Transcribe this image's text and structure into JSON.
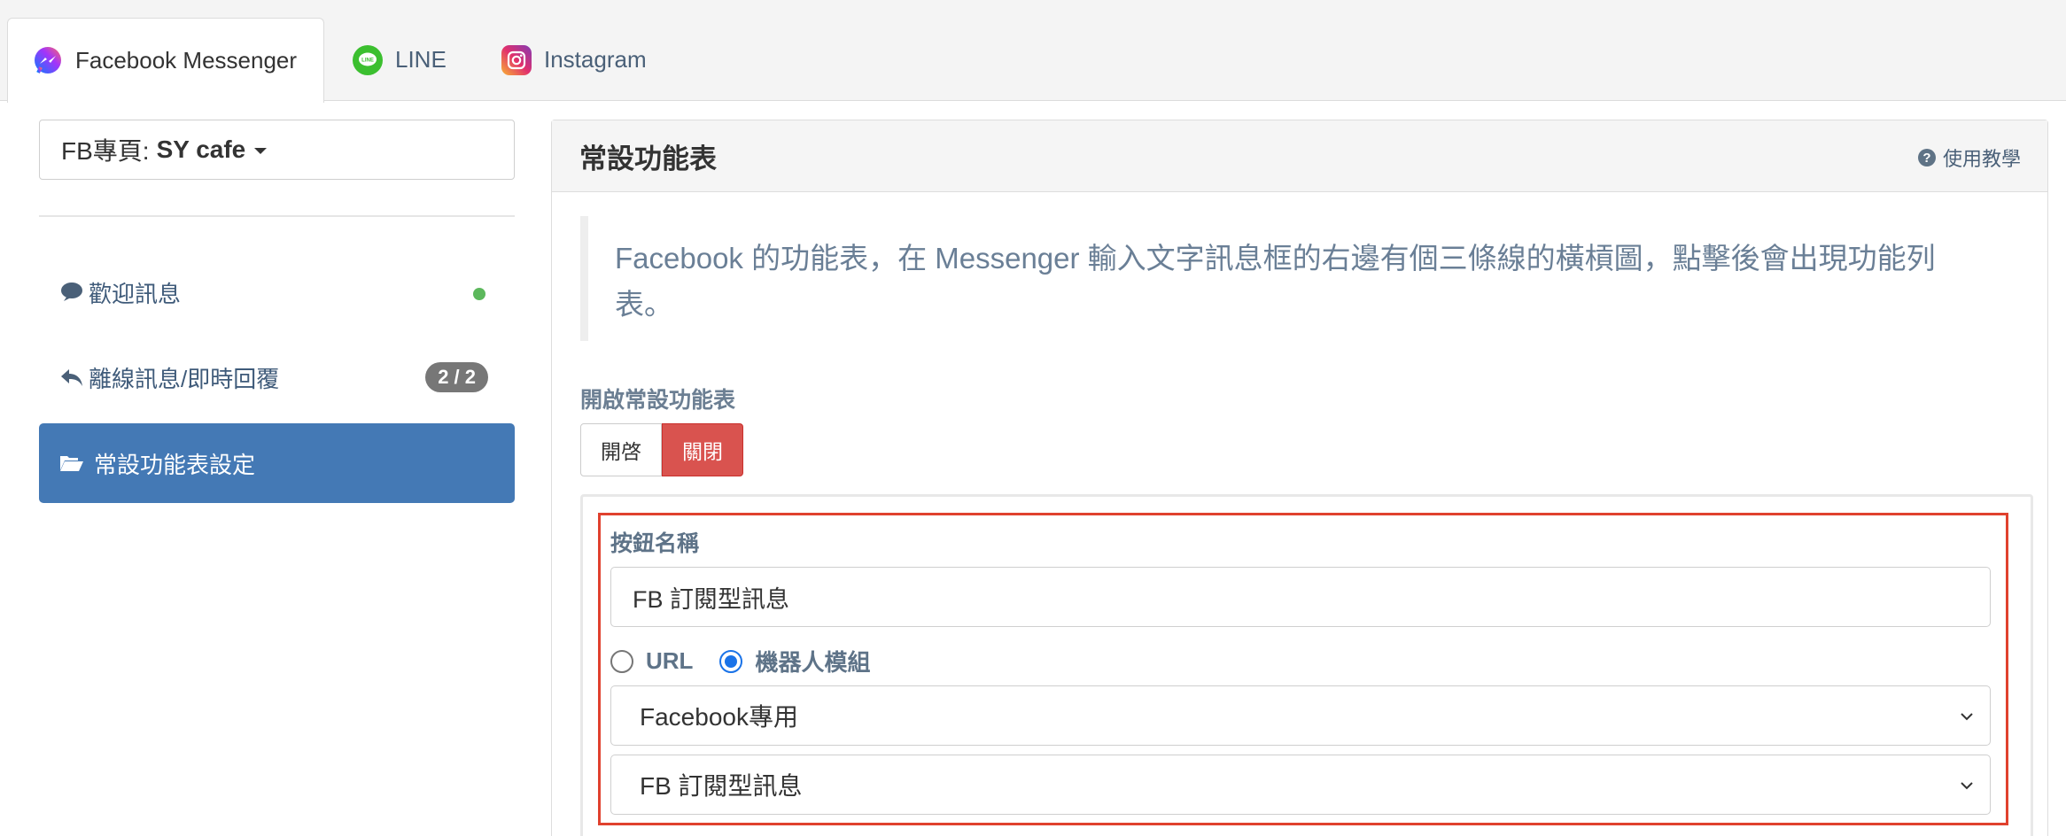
{
  "tabs": [
    {
      "label": "Facebook Messenger",
      "icon": "messenger-icon",
      "active": true
    },
    {
      "label": "LINE",
      "icon": "line-icon",
      "active": false
    },
    {
      "label": "Instagram",
      "icon": "instagram-icon",
      "active": false
    }
  ],
  "sidebar": {
    "page_prefix": "FB專頁:",
    "page_name": "SY cafe",
    "items": [
      {
        "label": "歡迎訊息",
        "icon": "comment-icon",
        "status_color": "#5cb85c"
      },
      {
        "label": "離線訊息/即時回覆",
        "icon": "reply-icon",
        "badge": "2 / 2"
      },
      {
        "label": "常設功能表設定",
        "icon": "folder-open-icon",
        "active": true
      }
    ]
  },
  "panel": {
    "title": "常設功能表",
    "help_label": "使用教學",
    "description": "Facebook 的功能表，在 Messenger 輸入文字訊息框的右邊有個三條線的橫槓圖，點擊後會出現功能列表。",
    "enable_label": "開啟常設功能表",
    "toggle": {
      "on_label": "開啓",
      "off_label": "關閉",
      "selected": "關閉"
    },
    "button_name_label": "按鈕名稱",
    "button_name_value": "FB 訂閱型訊息",
    "radio_url_label": "URL",
    "radio_bot_label": "機器人模組",
    "radio_selected": "機器人模組",
    "select_platform": "Facebook專用",
    "select_module": "FB 訂閱型訊息"
  },
  "colors": {
    "accent": "#4479b5",
    "danger": "#d9534f",
    "highlight_border": "#e0412e",
    "status_green": "#5cb85c"
  }
}
